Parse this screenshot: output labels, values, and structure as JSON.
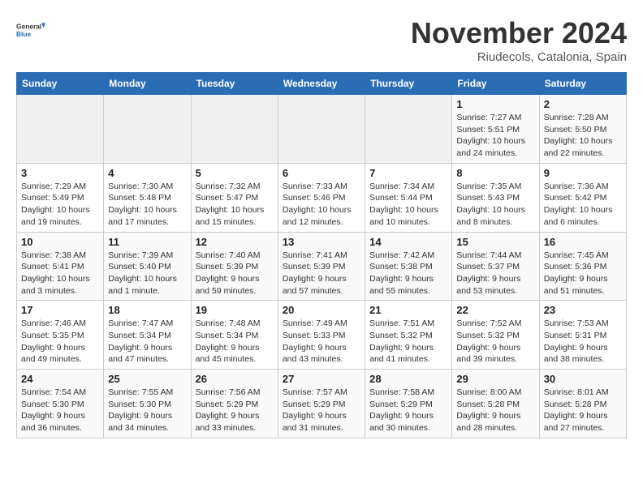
{
  "logo": {
    "general": "General",
    "blue": "Blue"
  },
  "title": "November 2024",
  "location": "Riudecols, Catalonia, Spain",
  "weekdays": [
    "Sunday",
    "Monday",
    "Tuesday",
    "Wednesday",
    "Thursday",
    "Friday",
    "Saturday"
  ],
  "weeks": [
    [
      {
        "day": "",
        "info": ""
      },
      {
        "day": "",
        "info": ""
      },
      {
        "day": "",
        "info": ""
      },
      {
        "day": "",
        "info": ""
      },
      {
        "day": "",
        "info": ""
      },
      {
        "day": "1",
        "info": "Sunrise: 7:27 AM\nSunset: 5:51 PM\nDaylight: 10 hours and 24 minutes."
      },
      {
        "day": "2",
        "info": "Sunrise: 7:28 AM\nSunset: 5:50 PM\nDaylight: 10 hours and 22 minutes."
      }
    ],
    [
      {
        "day": "3",
        "info": "Sunrise: 7:29 AM\nSunset: 5:49 PM\nDaylight: 10 hours and 19 minutes."
      },
      {
        "day": "4",
        "info": "Sunrise: 7:30 AM\nSunset: 5:48 PM\nDaylight: 10 hours and 17 minutes."
      },
      {
        "day": "5",
        "info": "Sunrise: 7:32 AM\nSunset: 5:47 PM\nDaylight: 10 hours and 15 minutes."
      },
      {
        "day": "6",
        "info": "Sunrise: 7:33 AM\nSunset: 5:46 PM\nDaylight: 10 hours and 12 minutes."
      },
      {
        "day": "7",
        "info": "Sunrise: 7:34 AM\nSunset: 5:44 PM\nDaylight: 10 hours and 10 minutes."
      },
      {
        "day": "8",
        "info": "Sunrise: 7:35 AM\nSunset: 5:43 PM\nDaylight: 10 hours and 8 minutes."
      },
      {
        "day": "9",
        "info": "Sunrise: 7:36 AM\nSunset: 5:42 PM\nDaylight: 10 hours and 6 minutes."
      }
    ],
    [
      {
        "day": "10",
        "info": "Sunrise: 7:38 AM\nSunset: 5:41 PM\nDaylight: 10 hours and 3 minutes."
      },
      {
        "day": "11",
        "info": "Sunrise: 7:39 AM\nSunset: 5:40 PM\nDaylight: 10 hours and 1 minute."
      },
      {
        "day": "12",
        "info": "Sunrise: 7:40 AM\nSunset: 5:39 PM\nDaylight: 9 hours and 59 minutes."
      },
      {
        "day": "13",
        "info": "Sunrise: 7:41 AM\nSunset: 5:39 PM\nDaylight: 9 hours and 57 minutes."
      },
      {
        "day": "14",
        "info": "Sunrise: 7:42 AM\nSunset: 5:38 PM\nDaylight: 9 hours and 55 minutes."
      },
      {
        "day": "15",
        "info": "Sunrise: 7:44 AM\nSunset: 5:37 PM\nDaylight: 9 hours and 53 minutes."
      },
      {
        "day": "16",
        "info": "Sunrise: 7:45 AM\nSunset: 5:36 PM\nDaylight: 9 hours and 51 minutes."
      }
    ],
    [
      {
        "day": "17",
        "info": "Sunrise: 7:46 AM\nSunset: 5:35 PM\nDaylight: 9 hours and 49 minutes."
      },
      {
        "day": "18",
        "info": "Sunrise: 7:47 AM\nSunset: 5:34 PM\nDaylight: 9 hours and 47 minutes."
      },
      {
        "day": "19",
        "info": "Sunrise: 7:48 AM\nSunset: 5:34 PM\nDaylight: 9 hours and 45 minutes."
      },
      {
        "day": "20",
        "info": "Sunrise: 7:49 AM\nSunset: 5:33 PM\nDaylight: 9 hours and 43 minutes."
      },
      {
        "day": "21",
        "info": "Sunrise: 7:51 AM\nSunset: 5:32 PM\nDaylight: 9 hours and 41 minutes."
      },
      {
        "day": "22",
        "info": "Sunrise: 7:52 AM\nSunset: 5:32 PM\nDaylight: 9 hours and 39 minutes."
      },
      {
        "day": "23",
        "info": "Sunrise: 7:53 AM\nSunset: 5:31 PM\nDaylight: 9 hours and 38 minutes."
      }
    ],
    [
      {
        "day": "24",
        "info": "Sunrise: 7:54 AM\nSunset: 5:30 PM\nDaylight: 9 hours and 36 minutes."
      },
      {
        "day": "25",
        "info": "Sunrise: 7:55 AM\nSunset: 5:30 PM\nDaylight: 9 hours and 34 minutes."
      },
      {
        "day": "26",
        "info": "Sunrise: 7:56 AM\nSunset: 5:29 PM\nDaylight: 9 hours and 33 minutes."
      },
      {
        "day": "27",
        "info": "Sunrise: 7:57 AM\nSunset: 5:29 PM\nDaylight: 9 hours and 31 minutes."
      },
      {
        "day": "28",
        "info": "Sunrise: 7:58 AM\nSunset: 5:29 PM\nDaylight: 9 hours and 30 minutes."
      },
      {
        "day": "29",
        "info": "Sunrise: 8:00 AM\nSunset: 5:28 PM\nDaylight: 9 hours and 28 minutes."
      },
      {
        "day": "30",
        "info": "Sunrise: 8:01 AM\nSunset: 5:28 PM\nDaylight: 9 hours and 27 minutes."
      }
    ]
  ]
}
